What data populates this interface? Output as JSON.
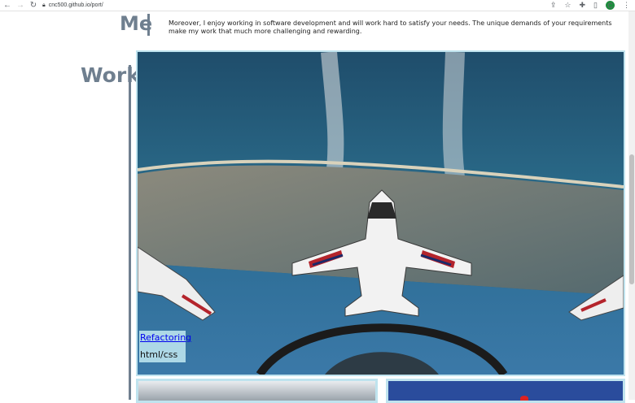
{
  "browser": {
    "url": "cnc500.github.io/port/",
    "avatar_letter": "C",
    "icons": [
      "back-icon",
      "forward-icon",
      "reload-icon",
      "lock-icon",
      "share-icon",
      "star-icon",
      "extensions-icon",
      "side-panel-icon",
      "menu-icon"
    ]
  },
  "about": {
    "heading": "Me",
    "text": "Moreover, I enjoy working in software development and will work hard to satisfy your needs. The unique demands of your requirements make my work that much more challenging and rewarding."
  },
  "work": {
    "heading": "Work",
    "projects": [
      {
        "title": "Refactoring",
        "tech": "html/css"
      }
    ]
  },
  "colors": {
    "heading": "#6f7f8f",
    "card_border": "#bfe3ee",
    "caption_bg": "#add8e6",
    "link": "#0000ee"
  }
}
